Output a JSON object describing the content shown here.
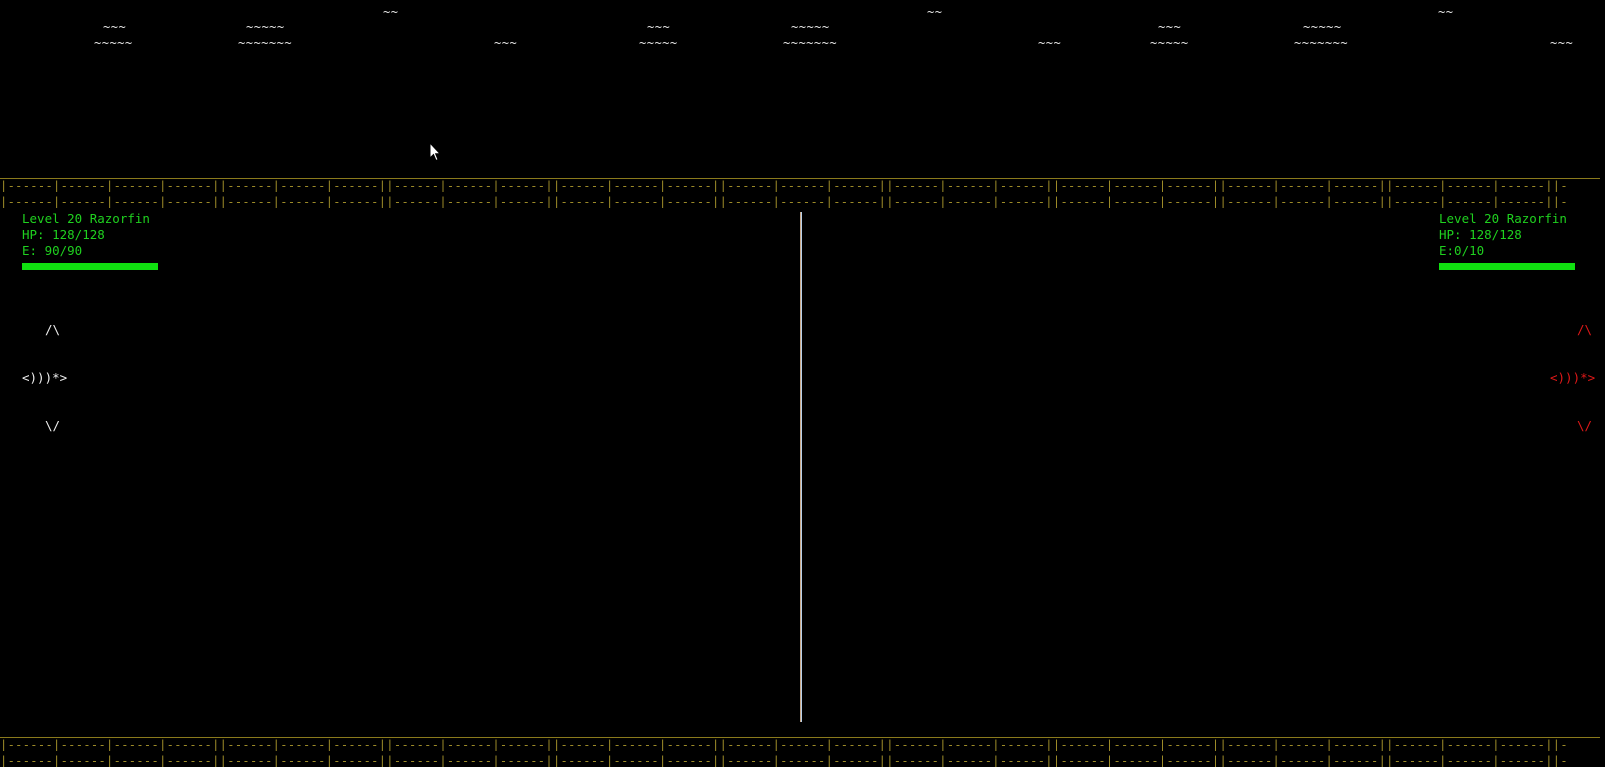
{
  "waves": {
    "w1": "~~",
    "w2": "~~~",
    "w3": "~~~~~",
    "w4": "~~~~~",
    "w5": "~~~~~~~",
    "w6": "~~~",
    "w7": "~~~",
    "w8": "~~~~~",
    "w9": "~~~~~",
    "w10": "~~~~~~~",
    "w11": "~~",
    "w12": "~~~",
    "w13": "~~~",
    "w14": "~~~~~",
    "w15": "~~~~~",
    "w16": "~~~~~~~",
    "w17": "~~",
    "w18": "~~~"
  },
  "ground": {
    "row_top_a": "|------|------|------|------||------|------|------||------|------|------||------|------|------||------|------|------||------|------|------||------|------|------||------|------|------||------|------|------||-",
    "row_top_b": "|------|------|------|------||------|------|------||------|------|------||------|------|------||------|------|------||------|------|------||------|------|------||------|------|------||------|------|------||-",
    "row_bot_a": "|------|------|------|------||------|------|------||------|------|------||------|------|------||------|------|------||------|------|------||------|------|------||------|------|------||------|------|------||-",
    "row_bot_b": "|------|------|------|------||------|------|------||------|------|------||------|------|------||------|------|------||------|------|------||------|------|------||------|------|------||------|------|------||-"
  },
  "player": {
    "name": "Level 20 Razorfin",
    "hp": "HP: 128/128",
    "energy": "E: 90/90",
    "bar_level": 1.0,
    "fish_top": "/\\",
    "fish_mid": "<)))*>",
    "fish_bot": "\\/"
  },
  "enemy": {
    "name": "Level 20 Razorfin",
    "hp": "HP: 128/128",
    "energy": "E:0/10",
    "bar_level": 1.0,
    "fish_top": "/\\",
    "fish_mid": "<)))*>",
    "fish_bot": "\\/"
  },
  "colors": {
    "background": "#000000",
    "stats_text": "#1fd11f",
    "bar_fill": "#10e010",
    "ground": "#9c8a28",
    "player_fish": "#f0f0f0",
    "enemy_fish": "#e01818"
  },
  "icons": {
    "cursor": "mouse-pointer-icon"
  }
}
